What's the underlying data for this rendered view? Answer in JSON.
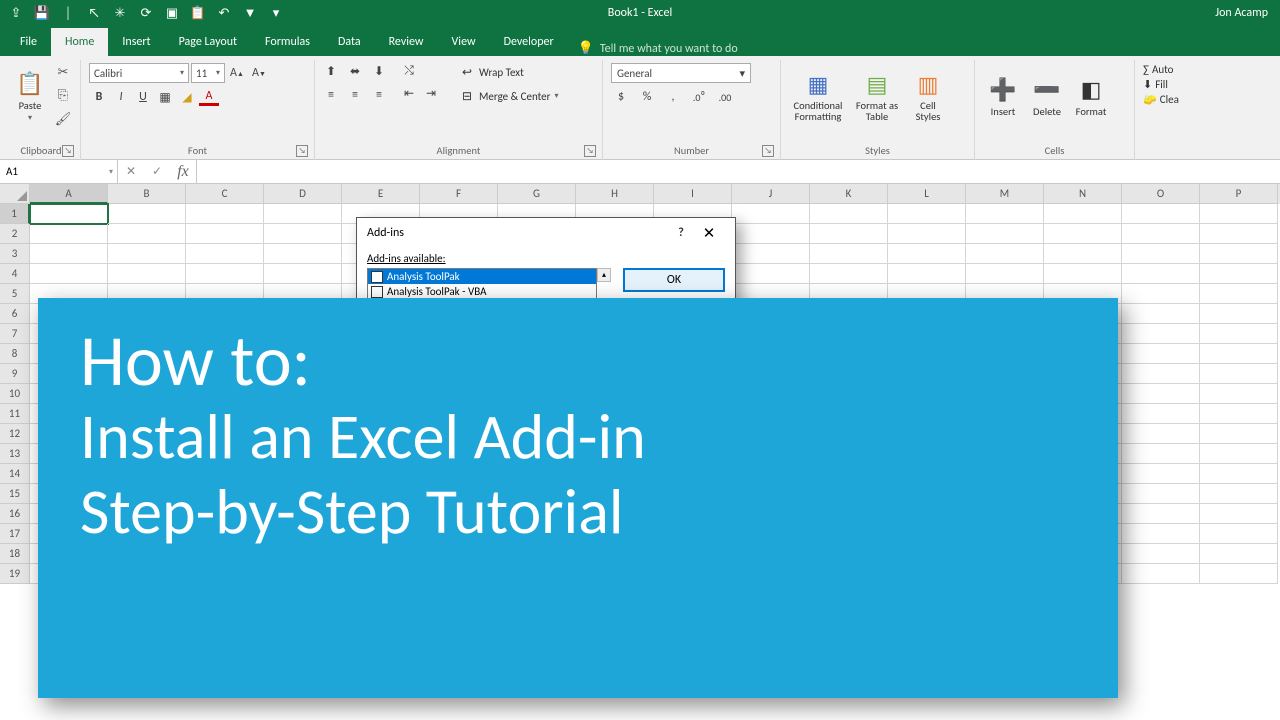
{
  "title": "Book1 - Excel",
  "user": "Jon Acamp",
  "tabs": {
    "file": "File",
    "home": "Home",
    "insert": "Insert",
    "page_layout": "Page Layout",
    "formulas": "Formulas",
    "data": "Data",
    "review": "Review",
    "view": "View",
    "developer": "Developer",
    "tellme": "Tell me what you want to do"
  },
  "ribbon": {
    "clipboard": {
      "label": "Clipboard",
      "paste": "Paste"
    },
    "font": {
      "label": "Font",
      "name": "Calibri",
      "size": "11"
    },
    "alignment": {
      "label": "Alignment",
      "wrap": "Wrap Text",
      "merge": "Merge & Center"
    },
    "number": {
      "label": "Number",
      "format": "General"
    },
    "styles": {
      "label": "Styles",
      "cond": "Conditional\nFormatting",
      "table": "Format as\nTable",
      "cell": "Cell\nStyles"
    },
    "cells": {
      "label": "Cells",
      "insert": "Insert",
      "delete": "Delete",
      "format": "Format"
    },
    "editing": {
      "autosum": "Auto",
      "fill": "Fill",
      "clear": "Clea"
    }
  },
  "namebox": "A1",
  "columns": [
    "A",
    "B",
    "C",
    "D",
    "E",
    "F",
    "G",
    "H",
    "I",
    "J",
    "K",
    "L",
    "M",
    "N",
    "O",
    "P"
  ],
  "rows": [
    "1",
    "2",
    "3",
    "4",
    "5",
    "6",
    "7",
    "8",
    "9",
    "10",
    "11",
    "12",
    "13",
    "14",
    "15",
    "16",
    "17",
    "18",
    "19"
  ],
  "dialog": {
    "title": "Add-ins",
    "avail": "Add-ins available:",
    "items": [
      "Analysis ToolPak",
      "Analysis ToolPak - VBA"
    ],
    "ok": "OK"
  },
  "overlay": {
    "heading": "How to:",
    "line1": "Install an Excel Add-in",
    "line2": "Step-by-Step Tutorial"
  }
}
